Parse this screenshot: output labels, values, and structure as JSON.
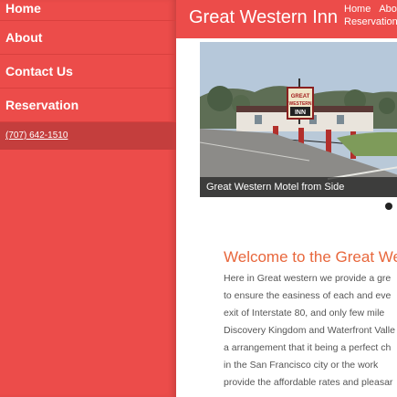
{
  "sidebar": {
    "items": [
      {
        "label": "Home"
      },
      {
        "label": "About"
      },
      {
        "label": "Contact Us"
      },
      {
        "label": "Reservation"
      }
    ],
    "phone": "(707) 642-1510"
  },
  "header": {
    "brand": "Great Western Inn",
    "top_nav": [
      "Home",
      "Abo",
      "Reservation"
    ]
  },
  "slider": {
    "caption": "Great Western Motel from Side",
    "image_sign": [
      "GREAT",
      "WESTERN",
      "INN"
    ]
  },
  "welcome": {
    "title": "Welcome to the Great Weste",
    "lines": [
      "Here in Great western we provide a gre",
      "to ensure the easiness of each and eve",
      "exit of Interstate 80, and only few mile",
      "Discovery Kingdom and Waterfront Valle",
      "a arrangement that it being a perfect ch",
      "in the San Francisco city or the work",
      "provide the affordable rates and pleasar"
    ]
  },
  "colors": {
    "primary": "#ec4c4a",
    "primary_dark": "#c43e3d",
    "accent": "#e8673c",
    "text": "#555555"
  }
}
